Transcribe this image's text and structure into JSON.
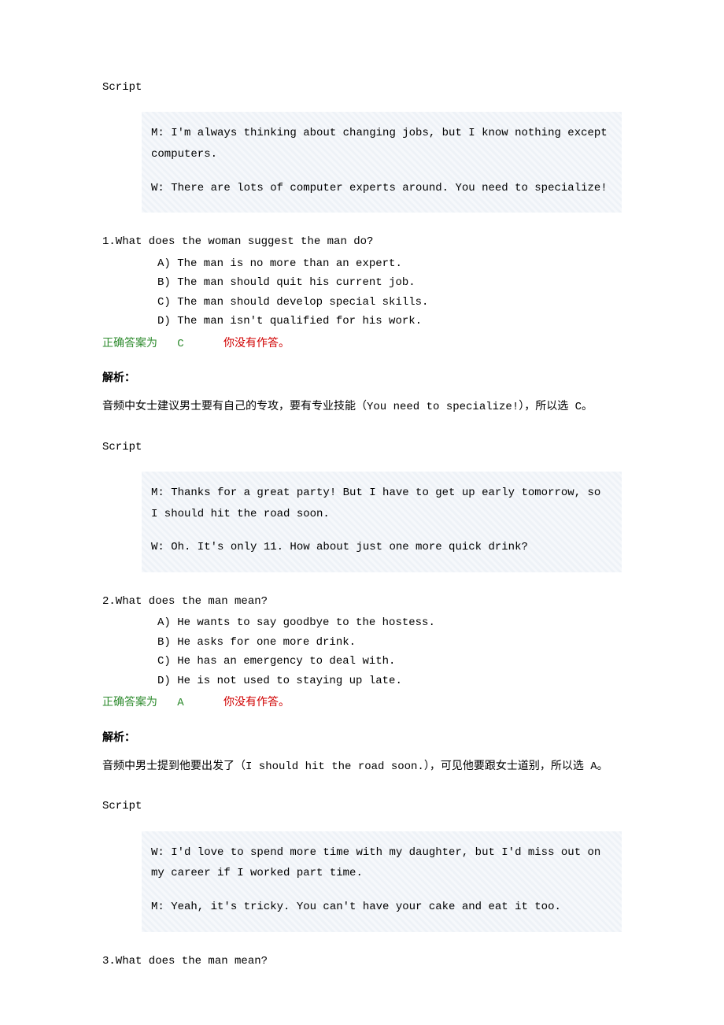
{
  "labels": {
    "script": "Script",
    "correct_prefix": "正确答案为",
    "not_answered": "你没有作答。",
    "explain": "解析："
  },
  "q1": {
    "script_m": "M: I'm always thinking about changing jobs, but I know nothing except computers.",
    "script_w": "W: There are lots of computer experts around. You need to specialize!",
    "question": "1.What does the woman suggest the man do?",
    "opt_a": "A) The man is no more than an expert.",
    "opt_b": "B) The man should quit his current job.",
    "opt_c": "C) The man should develop special skills.",
    "opt_d": "D) The man isn't qualified for his work.",
    "correct": "C",
    "explanation": "音频中女士建议男士要有自己的专攻，要有专业技能（You need to specialize!），所以选 C。"
  },
  "q2": {
    "script_m": "M: Thanks for a great party! But I have to get up early tomorrow, so I should hit the road soon.",
    "script_w": "W: Oh. It's only 11. How about just one more quick drink?",
    "question": "2.What does the man mean?",
    "opt_a": "A) He wants to say goodbye to the hostess.",
    "opt_b": "B) He asks for one more drink.",
    "opt_c": "C) He has an emergency to deal with.",
    "opt_d": "D) He is not used to staying up late.",
    "correct": "A",
    "explanation": "音频中男士提到他要出发了（I should hit the road soon.），可见他要跟女士道别，所以选 A。"
  },
  "q3": {
    "script_w": "W: I'd love to spend more time with my daughter, but I'd miss out on my career if I worked part time.",
    "script_m": "M: Yeah, it's tricky. You can't have your cake and eat it too.",
    "question": "3.What does the man mean?"
  }
}
